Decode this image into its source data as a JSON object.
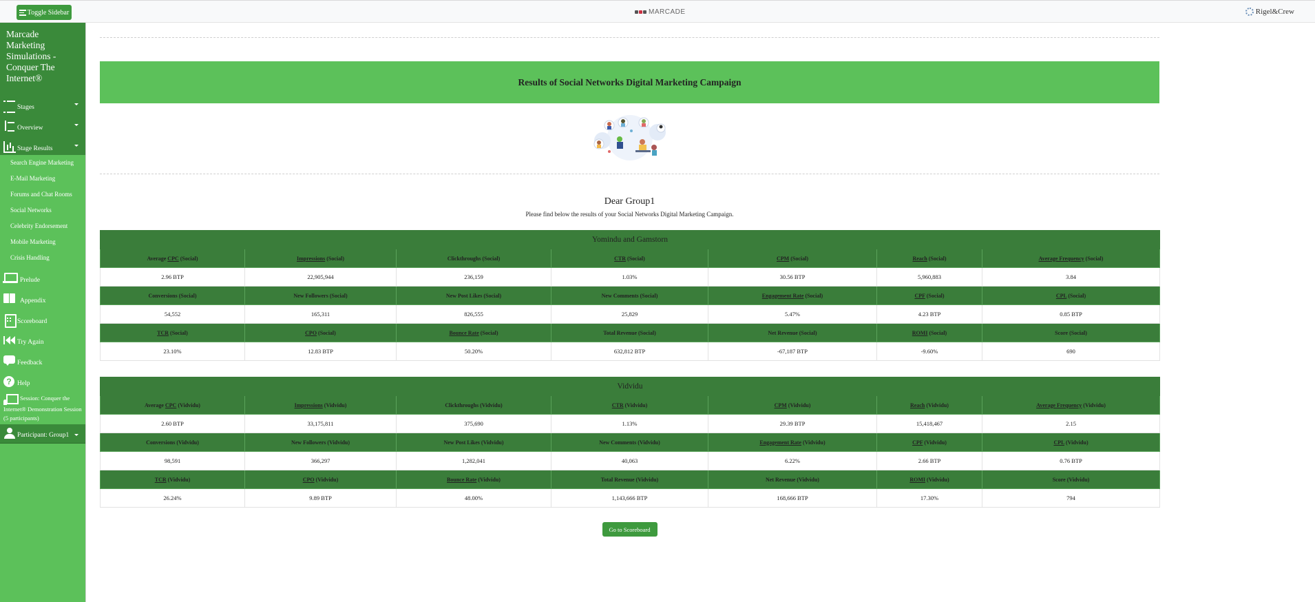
{
  "topbar": {
    "toggle_label": "Toggle Sidebar",
    "brand_center": "MARCADE",
    "brand_right": "Rigel&Crew"
  },
  "sidebar": {
    "title": "Marcade Marketing Simulations - Conquer The Internet®",
    "nav": {
      "stages": "Stages",
      "overview": "Overview",
      "stage_results": "Stage Results",
      "prelude": "Prelude",
      "appendix": "Appendix",
      "scoreboard": "Scoreboard",
      "try_again": "Try Again",
      "feedback": "Feedback",
      "help": "Help",
      "session": "Session: Conquer the Internet® Demonstration Session (5 participants)",
      "participant": "Participant: Group1"
    },
    "stage_results_items": [
      "Search Engine Marketing",
      "E-Mail Marketing",
      "Forums and Chat Rooms",
      "Social Networks",
      "Celebrity Endorsement",
      "Mobile Marketing",
      "Crisis Handling"
    ]
  },
  "main": {
    "banner_title": "Results of Social Networks Digital Marketing Campaign",
    "greeting": "Dear Group1",
    "intro": "Please find below the results of your Social Networks Digital Marketing Campaign.",
    "scoreboard_button": "Go to Scoreboard"
  },
  "tables": [
    {
      "title": "Yomindu and Gamstorn",
      "suffix": "(Social)",
      "rows": [
        {
          "headers": [
            {
              "abbr": "CPC",
              "pre": "Average ",
              "post": ""
            },
            {
              "abbr": "Impressions",
              "pre": "",
              "post": ""
            },
            {
              "abbr": "",
              "pre": "Clickthroughs",
              "post": ""
            },
            {
              "abbr": "CTR",
              "pre": "",
              "post": ""
            },
            {
              "abbr": "CPM",
              "pre": "",
              "post": ""
            },
            {
              "abbr": "Reach",
              "pre": "",
              "post": ""
            },
            {
              "abbr": "Average Frequency",
              "pre": "",
              "post": ""
            }
          ],
          "values": [
            "2.96 BTP",
            "22,905,944",
            "236,159",
            "1.03%",
            "30.56 BTP",
            "5,960,883",
            "3.84"
          ]
        },
        {
          "headers": [
            {
              "abbr": "",
              "pre": "Conversions",
              "post": ""
            },
            {
              "abbr": "",
              "pre": "New Followers",
              "post": ""
            },
            {
              "abbr": "",
              "pre": "New Post Likes",
              "post": ""
            },
            {
              "abbr": "",
              "pre": "New Comments",
              "post": ""
            },
            {
              "abbr": "Engagement Rate",
              "pre": "",
              "post": ""
            },
            {
              "abbr": "CPF",
              "pre": "",
              "post": ""
            },
            {
              "abbr": "CPL",
              "pre": "",
              "post": ""
            }
          ],
          "values": [
            "54,552",
            "165,311",
            "826,555",
            "25,829",
            "5.47%",
            "4.23 BTP",
            "0.85 BTP"
          ]
        },
        {
          "headers": [
            {
              "abbr": "TCR",
              "pre": "",
              "post": ""
            },
            {
              "abbr": "CPO",
              "pre": "",
              "post": ""
            },
            {
              "abbr": "Bounce Rate",
              "pre": "",
              "post": ""
            },
            {
              "abbr": "",
              "pre": "Total Revenue",
              "post": ""
            },
            {
              "abbr": "",
              "pre": "Net Revenue",
              "post": ""
            },
            {
              "abbr": "ROMI",
              "pre": "",
              "post": ""
            },
            {
              "abbr": "",
              "pre": "Score",
              "post": ""
            }
          ],
          "values": [
            "23.10%",
            "12.83 BTP",
            "50.20%",
            "632,812 BTP",
            "-67,187 BTP",
            "-9.60%",
            "690"
          ]
        }
      ]
    },
    {
      "title": "Vidvidu",
      "suffix": "(Vidvidu)",
      "rows": [
        {
          "headers": [
            {
              "abbr": "CPC",
              "pre": "Average ",
              "post": ""
            },
            {
              "abbr": "Impressions",
              "pre": "",
              "post": ""
            },
            {
              "abbr": "",
              "pre": "Clickthroughs",
              "post": ""
            },
            {
              "abbr": "CTR",
              "pre": "",
              "post": ""
            },
            {
              "abbr": "CPM",
              "pre": "",
              "post": ""
            },
            {
              "abbr": "Reach",
              "pre": "",
              "post": ""
            },
            {
              "abbr": "Average Frequency",
              "pre": "",
              "post": ""
            }
          ],
          "values": [
            "2.60 BTP",
            "33,175,811",
            "375,690",
            "1.13%",
            "29.39 BTP",
            "15,418,467",
            "2.15"
          ]
        },
        {
          "headers": [
            {
              "abbr": "",
              "pre": "Conversions",
              "post": ""
            },
            {
              "abbr": "",
              "pre": "New Followers",
              "post": ""
            },
            {
              "abbr": "",
              "pre": "New Post Likes",
              "post": ""
            },
            {
              "abbr": "",
              "pre": "New Comments",
              "post": ""
            },
            {
              "abbr": "Engagement Rate",
              "pre": "",
              "post": ""
            },
            {
              "abbr": "CPF",
              "pre": "",
              "post": ""
            },
            {
              "abbr": "CPL",
              "pre": "",
              "post": ""
            }
          ],
          "values": [
            "98,591",
            "366,297",
            "1,282,041",
            "40,063",
            "6.22%",
            "2.66 BTP",
            "0.76 BTP"
          ]
        },
        {
          "headers": [
            {
              "abbr": "TCR",
              "pre": "",
              "post": ""
            },
            {
              "abbr": "CPO",
              "pre": "",
              "post": ""
            },
            {
              "abbr": "Bounce Rate",
              "pre": "",
              "post": ""
            },
            {
              "abbr": "",
              "pre": "Total Revenue",
              "post": ""
            },
            {
              "abbr": "",
              "pre": "Net Revenue",
              "post": ""
            },
            {
              "abbr": "ROMI",
              "pre": "",
              "post": ""
            },
            {
              "abbr": "",
              "pre": "Score",
              "post": ""
            }
          ],
          "values": [
            "26.24%",
            "9.89 BTP",
            "48.00%",
            "1,143,666 BTP",
            "168,666 BTP",
            "17.30%",
            "794"
          ]
        }
      ]
    }
  ],
  "colors": {
    "sidebar_green": "#5cc15a",
    "sidebar_dark_green": "#3a8a3a",
    "table_header_green": "#3a7d3a",
    "button_green": "#3e9a3e"
  }
}
